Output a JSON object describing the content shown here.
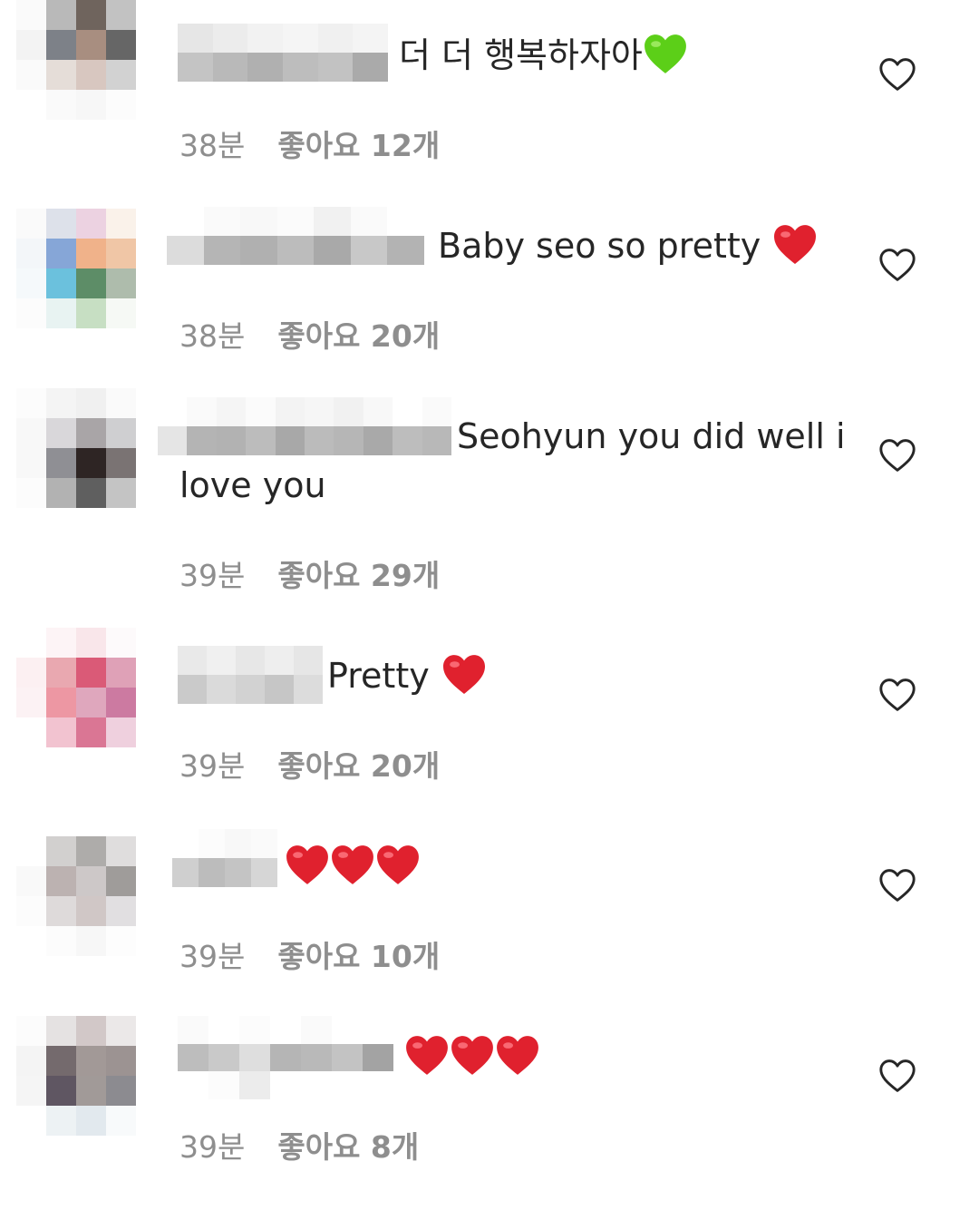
{
  "comments": [
    {
      "text": "더 더 행복하자아",
      "emoji": "green-heart",
      "time": "38분",
      "likes": "좋아요 12개"
    },
    {
      "text": "Baby seo so pretty ",
      "emoji": "red-heart",
      "time": "38분",
      "likes": "좋아요 20개"
    },
    {
      "text": "Seohyun you did well i",
      "text2": "love you",
      "emoji": "",
      "time": "39분",
      "likes": "좋아요 29개"
    },
    {
      "text": "Pretty ",
      "emoji": "red-heart",
      "time": "39분",
      "likes": "좋아요 20개"
    },
    {
      "text": "",
      "emoji": "red-heart x3",
      "time": "39분",
      "likes": "좋아요 10개"
    },
    {
      "text": "",
      "emoji": "red-heart x3",
      "time": "39분",
      "likes": "좋아요 8개"
    }
  ],
  "icons": {
    "like": "heart-outline-icon"
  },
  "colors": {
    "text": "#262626",
    "meta": "#8e8e8e",
    "red_heart": "#e0212e",
    "green_heart": "#5ccf18"
  }
}
